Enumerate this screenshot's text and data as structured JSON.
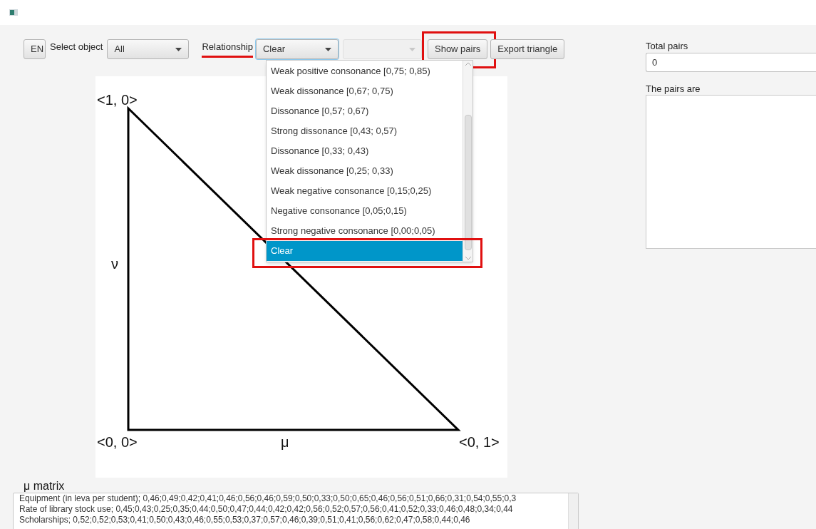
{
  "toolbar": {
    "language_button": "EN",
    "object_label": "Select object",
    "object_combo": {
      "value": "All"
    },
    "relationship_label": {
      "text": "Relationship",
      "underlined": true
    },
    "relationship_combo": {
      "value": "Clear",
      "focused": true
    },
    "second_combo": {
      "disabled": true
    },
    "show_pairs_button": {
      "label": "Show pairs",
      "highlighted": true
    },
    "export_button": {
      "label": "Export triangle",
      "highlighted": false
    }
  },
  "relationship_options": [
    {
      "label": "Weak positive consonance [0,75; 0,85)",
      "selected": false,
      "highlighted": false
    },
    {
      "label": "Weak dissonance [0,67; 0,75)",
      "selected": false,
      "highlighted": false
    },
    {
      "label": "Dissonance [0,57; 0,67)",
      "selected": false,
      "highlighted": false
    },
    {
      "label": "Strong dissonance [0,43; 0,57)",
      "selected": false,
      "highlighted": false
    },
    {
      "label": "Dissonance [0,33; 0,43)",
      "selected": false,
      "highlighted": false
    },
    {
      "label": "Weak dissonance [0,25; 0,33)",
      "selected": false,
      "highlighted": false
    },
    {
      "label": "Weak negative consonance [0,15;0,25)",
      "selected": false,
      "highlighted": false
    },
    {
      "label": "Negative consonance [0,05;0,15)",
      "selected": false,
      "highlighted": false
    },
    {
      "label": "Strong negative consonance [0,00;0,05)",
      "selected": false,
      "highlighted": false
    },
    {
      "label": "Clear",
      "selected": true,
      "highlighted": true
    }
  ],
  "triangle": {
    "top_label": "<1, 0>",
    "origin_label": "<0, 0>",
    "right_label": "<0, 1>",
    "y_axis_label": "ν",
    "x_axis_label": "μ"
  },
  "matrix": {
    "label": "μ matrix",
    "lines": [
      "Equipment (in leva per student); 0,46;0,49;0,42;0,41;0,46;0,56;0,46;0,59;0,50;0,33;0,50;0,65;0,46;0,56;0,51;0,66;0,31;0,54;0,55;0,3",
      "Rate of library stock use; 0,45;0,43;0,25;0,35;0,44;0,50;0,47;0,44;0,42;0,42;0,56;0,52;0,57;0,56;0,41;0,52;0,33;0,46;0,48;0,34;0,44",
      "Scholarships; 0,52;0,52;0,53;0,41;0,50;0,43;0,46;0,55;0,53;0,37;0,57;0,46;0,39;0,51;0,41;0,56;0,62;0,47;0,58;0,44;0,46"
    ]
  },
  "side": {
    "total_label": "Total pairs",
    "total_value": "0",
    "pairs_label": "The pairs are"
  }
}
